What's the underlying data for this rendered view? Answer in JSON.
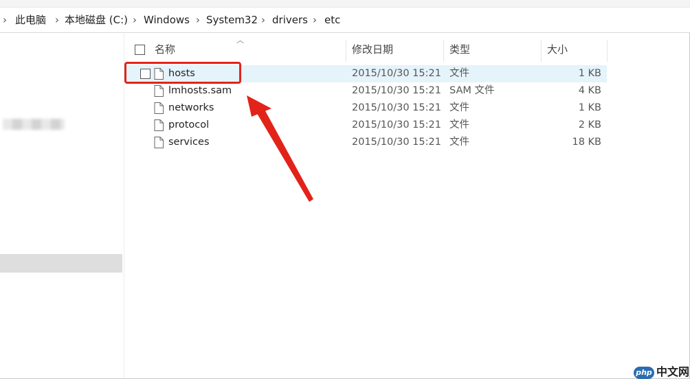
{
  "breadcrumb": {
    "items": [
      "此电脑",
      "本地磁盘 (C:)",
      "Windows",
      "System32",
      "drivers",
      "etc"
    ]
  },
  "columns": {
    "name": "名称",
    "date": "修改日期",
    "type": "类型",
    "size": "大小"
  },
  "files": [
    {
      "name": "hosts",
      "date": "2015/10/30 15:21",
      "type": "文件",
      "size": "1 KB"
    },
    {
      "name": "lmhosts.sam",
      "date": "2015/10/30 15:21",
      "type": "SAM 文件",
      "size": "4 KB"
    },
    {
      "name": "networks",
      "date": "2015/10/30 15:21",
      "type": "文件",
      "size": "1 KB"
    },
    {
      "name": "protocol",
      "date": "2015/10/30 15:21",
      "type": "文件",
      "size": "2 KB"
    },
    {
      "name": "services",
      "date": "2015/10/30 15:21",
      "type": "文件",
      "size": "18 KB"
    }
  ],
  "watermark": {
    "logo": "php",
    "text": "中文网"
  },
  "colors": {
    "highlight": "#e2231a",
    "selection": "#e5f3fb",
    "watermark_logo": "#2a6db0"
  }
}
